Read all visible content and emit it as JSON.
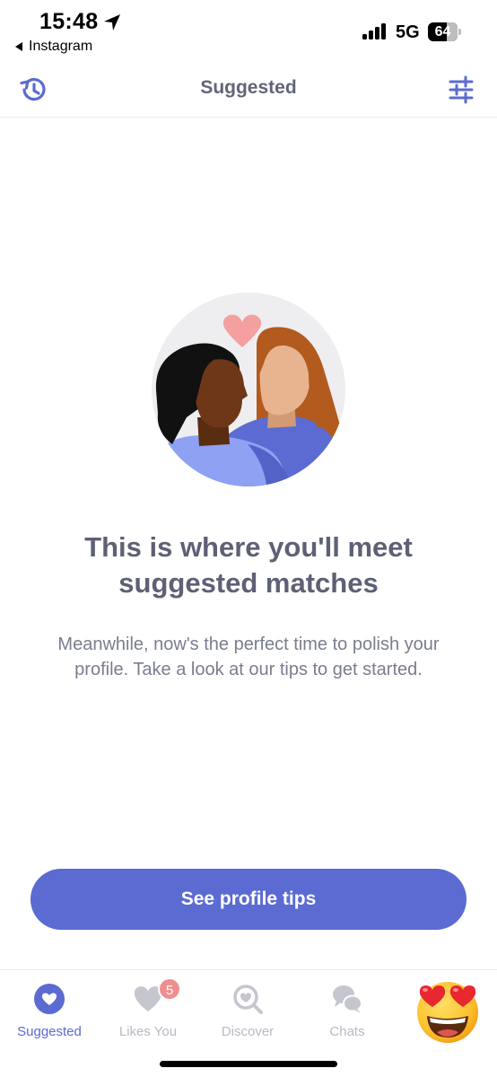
{
  "status_bar": {
    "time": "15:48",
    "back_app": "Instagram",
    "network": "5G",
    "battery": "64",
    "battery_level": 0.64
  },
  "nav": {
    "title": "Suggested",
    "left_icon": "history-icon",
    "right_icon": "filter-sliders-icon"
  },
  "empty_state": {
    "illustration": "couple-illustration",
    "headline": "This is where you'll meet suggested matches",
    "body": "Meanwhile, now's the perfect time to polish your profile. Take a look at our tips to get started.",
    "cta_label": "See profile tips"
  },
  "tabs": [
    {
      "label": "Suggested",
      "icon": "heart-circle-icon",
      "active": true
    },
    {
      "label": "Likes You",
      "icon": "heart-icon",
      "badge": "5",
      "active": false
    },
    {
      "label": "Discover",
      "icon": "search-heart-icon",
      "active": false
    },
    {
      "label": "Chats",
      "icon": "chat-bubbles-icon",
      "active": false
    }
  ],
  "profile_tab": {
    "icon": "heart-eyes-emoji-icon"
  },
  "colors": {
    "accent": "#5b6bd2",
    "title_text": "#62647a",
    "body_text": "#7a7d8f",
    "inactive": "#b9bac4",
    "badge": "#ef8e8e"
  }
}
